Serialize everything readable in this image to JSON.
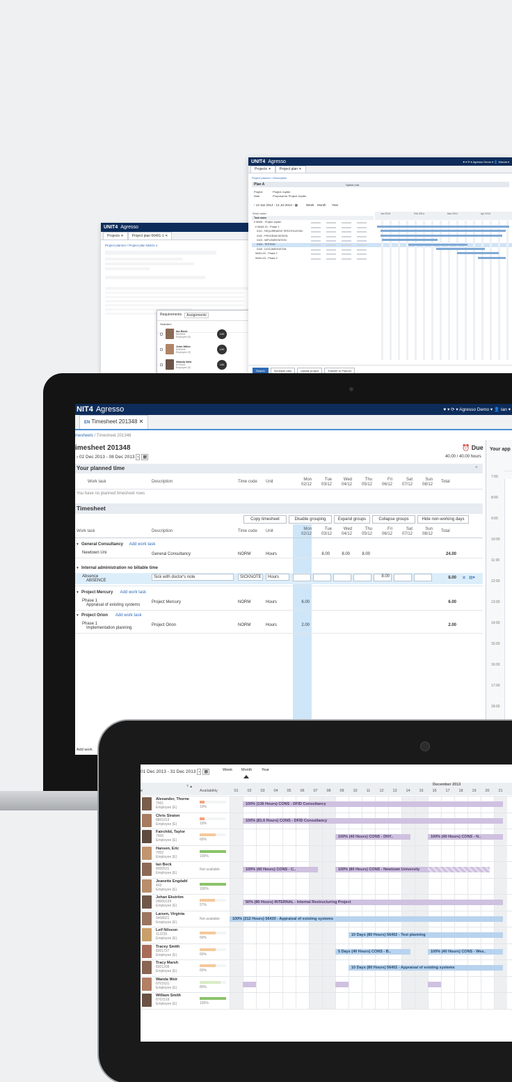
{
  "back_left": {
    "brand": "UNIT4",
    "product": "Agresso",
    "tabs": [
      "Projects ✕",
      "Project plan 06401-1 ✕"
    ],
    "breadcrumb": "Project planner / Project plan 06401-1",
    "popup": {
      "tabs": [
        "Requirements",
        "Assignments"
      ],
      "selected_label": "Selected:",
      "col_name": "Name",
      "people": [
        {
          "name": "Ian Beck",
          "id": "8000531",
          "role": "Employee (E)",
          "badge": "100"
        },
        {
          "name": "John Miller",
          "id": "8000046",
          "role": "Employee (E)",
          "badge": "100"
        },
        {
          "name": "Wanda Weir",
          "id": "8701631",
          "role": "Employee (E)",
          "badge": "100"
        }
      ]
    }
  },
  "back_right": {
    "brand": "UNIT4",
    "product": "Agresso",
    "userbar": "♥ ▾   ⟳ ▾   Agresso Demo ▾   👤 Wanda ▾",
    "tabs": [
      "Projects ✕",
      "Project plan ✕"
    ],
    "breadcrumb": "Project planner / Description",
    "plan_title": "Plan A",
    "plan_option": "Option   List",
    "project_label": "Project",
    "project_value": "Project Jupiter",
    "note_label": "Note",
    "note_value": "Proposal for Project Jupiter",
    "date_range": "‹ 13 Jan 2014 - 13 Jul 2014 ›  ▦",
    "view_modes": [
      "Week",
      "Month",
      "Year"
    ],
    "work_tasks_label": "Work tasks",
    "tasks": [
      {
        "name": "Task name",
        "bold": true
      },
      {
        "name": "▾ 06401 - Project Jupiter",
        "bold": false
      },
      {
        "name": "  ▾ 06401-01 - Phase 1",
        "bold": false
      },
      {
        "name": "    0101 - REQUIREMENT SPECIFICATION",
        "bold": false
      },
      {
        "name": "    0102 - PROGRAM DESIGN",
        "bold": false
      },
      {
        "name": "    0103 - IMPLEMENTATION",
        "bold": false
      },
      {
        "name": "    0104 - TESTING",
        "bold": false,
        "selected": true
      },
      {
        "name": "    0105 - DOCUMENTATION",
        "bold": false
      },
      {
        "name": "  06401-02 - Phase 2",
        "bold": false
      },
      {
        "name": "  06401-03 - Phase 3",
        "bold": false
      }
    ],
    "gantt_months": [
      "Jan 2014",
      "Feb 2014",
      "Mar 2014",
      "Apr 2014"
    ],
    "footer_buttons": [
      "Search",
      "Schedule plan",
      "Update project",
      "Transfer to Planner"
    ]
  },
  "laptop": {
    "brand_partial": "NIT4",
    "product": "Agresso",
    "userbar": "♥ ▾   ⟳ ▾   Agresso Demo ▾   👤 Ian ▾",
    "tab_icon": "EN",
    "tab_label": "Timesheet 201348",
    "breadcrumb": [
      "mesheets",
      "Timesheet 201348"
    ],
    "page_title": "imesheet 201348",
    "date_range": "02 Dec 2013 - 08 Dec 2013",
    "due_label": "Due",
    "hours_summary": "40.00 / 40.00 hours",
    "planned_title": "Your planned time",
    "planned_columns": [
      "Work task",
      "Description",
      "Time code",
      "Unit"
    ],
    "days": [
      {
        "day": "Mon",
        "date": "02/12"
      },
      {
        "day": "Tue",
        "date": "03/12"
      },
      {
        "day": "Wed",
        "date": "04/12"
      },
      {
        "day": "Thu",
        "date": "05/12"
      },
      {
        "day": "Fri",
        "date": "06/12"
      },
      {
        "day": "Sat",
        "date": "07/12"
      },
      {
        "day": "Sun",
        "date": "08/12"
      }
    ],
    "total_label": "Total",
    "no_planned_rows": "You have no planned timesheet rows",
    "timesheet_title": "Timesheet",
    "toolbar": [
      "Copy timesheet",
      "Disable grouping",
      "Expand groups",
      "Collapse groups",
      "Hide non-working days"
    ],
    "ts_columns": [
      "Work task",
      "Description",
      "Time code",
      "Unit"
    ],
    "groups": [
      {
        "title": "General Consultancy",
        "add": "Add work task",
        "rows": [
          {
            "task": "Newtown Uni",
            "sub": "",
            "desc": "General Consultancy",
            "code": "NORM",
            "unit": "Hours",
            "hours": [
              "",
              "8.00",
              "8.00",
              "8.00",
              "",
              "",
              ""
            ],
            "total": "24.00"
          }
        ]
      },
      {
        "title": "Internal administration no billable time",
        "add": "",
        "rows": [
          {
            "task": "Absence",
            "sub": "ABSENCE",
            "desc": "Sick with doctor's note",
            "code": "SICKNOTE",
            "unit": "Hours",
            "hours": [
              "",
              "",
              "",
              "",
              "8.00",
              "",
              ""
            ],
            "total": "8.00",
            "editing": true
          }
        ]
      },
      {
        "title": "Project Mercury",
        "add": "Add work task",
        "rows": [
          {
            "task": "Phase 1",
            "sub": "Appraisal of existing systems",
            "desc": "Project Mercury",
            "code": "NORM",
            "unit": "Hours",
            "hours": [
              "6.00",
              "",
              "",
              "",
              "",
              "",
              ""
            ],
            "total": "6.00"
          }
        ]
      },
      {
        "title": "Project Orion",
        "add": "Add work task",
        "rows": [
          {
            "task": "Phase 1",
            "sub": "Implementation planning",
            "desc": "Project Orion",
            "code": "NORM",
            "unit": "Hours",
            "hours": [
              "2.00",
              "",
              "",
              "",
              "",
              "",
              ""
            ],
            "total": "2.00"
          }
        ]
      }
    ],
    "add_work_label": "Add work",
    "appointments_title": "Your app",
    "cal_times": [
      "7:00",
      "8:00",
      "9:00",
      "10:00",
      "11:00",
      "12:00",
      "13:00",
      "14:00",
      "15:00",
      "16:00",
      "17:00",
      "18:00"
    ]
  },
  "tablet": {
    "date_range": "01 Dec 2013 - 31 Dec 2013",
    "view_modes": [
      "Week",
      "Month",
      "Year"
    ],
    "col_resource_partial": "e",
    "sort_icon": "? ▲",
    "col_availability": "Availability",
    "month_label": "December 2013",
    "days": [
      "01",
      "02",
      "03",
      "04",
      "05",
      "06",
      "07",
      "08",
      "09",
      "10",
      "11",
      "12",
      "13",
      "14",
      "15",
      "16",
      "17",
      "18",
      "19",
      "20",
      "21"
    ],
    "people": [
      {
        "name": "Alexander, Thorne",
        "id": "7001",
        "role": "Employee (E)",
        "avail": "19%",
        "bar_color": "#f3a37a",
        "avail_frac": 0.19
      },
      {
        "name": "Chris Siraton",
        "id": "8801013",
        "role": "Employee (E)",
        "avail": "19%",
        "bar_color": "#f3a37a",
        "avail_frac": 0.19
      },
      {
        "name": "Fairchild, Taylor",
        "id": "7006",
        "role": "Employee (E)",
        "avail": "60%",
        "bar_color": "#f5c99a",
        "avail_frac": 0.6
      },
      {
        "name": "Hansen, Eric",
        "id": "7002",
        "role": "Employee (E)",
        "avail": "100%",
        "bar_color": "#8bc36a",
        "avail_frac": 1.0
      },
      {
        "name": "Ian Beck",
        "id": "8000531",
        "role": "Employee (E)",
        "avail": "Not available",
        "bar_color": "",
        "avail_frac": 0
      },
      {
        "name": "Jeanette Engdahl",
        "id": "403",
        "role": "Employee (E)",
        "avail": "100%",
        "bar_color": "#8bc36a",
        "avail_frac": 1.0
      },
      {
        "name": "Johan Ekström",
        "id": "99000139",
        "role": "Employee (E)",
        "avail": "57%",
        "bar_color": "#f5c99a",
        "avail_frac": 0.57
      },
      {
        "name": "Larsen, Virginia",
        "id": "9408021",
        "role": "Employee (E)",
        "avail": "Not available",
        "bar_color": "",
        "avail_frac": 0
      },
      {
        "name": "Leif Nilsson",
        "id": "112233",
        "role": "Employee (E)",
        "avail": "60%",
        "bar_color": "#f5c99a",
        "avail_frac": 0.6
      },
      {
        "name": "Tracey Smith",
        "id": "8301727",
        "role": "Employee (E)",
        "avail": "60%",
        "bar_color": "#f5c99a",
        "avail_frac": 0.6
      },
      {
        "name": "Tracy Marsh",
        "id": "8301208",
        "role": "Employee (E)",
        "avail": "60%",
        "bar_color": "#f5c99a",
        "avail_frac": 0.6
      },
      {
        "name": "Wanda Weir",
        "id": "8701631",
        "role": "Employee (E)",
        "avail": "80%",
        "bar_color": "#d8ecc5",
        "avail_frac": 0.8
      },
      {
        "name": "William Smith",
        "id": "8701519",
        "role": "Employee (E)",
        "avail": "100%",
        "bar_color": "#8bc36a",
        "avail_frac": 1.0
      }
    ],
    "bookings": [
      {
        "row": 0,
        "start": 2,
        "end": 21,
        "label": "100% (136 Hours) CONS - DFID Consultancy",
        "style": "purple"
      },
      {
        "row": 1,
        "start": 2,
        "end": 21,
        "label": "100% (81.6 Hours) CONS - DFID Consultancy",
        "style": "purple"
      },
      {
        "row": 2,
        "start": 9,
        "end": 14,
        "label": "100% (40 Hours) CONS - DNY..",
        "style": "purple"
      },
      {
        "row": 2,
        "start": 16,
        "end": 21,
        "label": "100% (40 Hours) CONS - N..",
        "style": "purple"
      },
      {
        "row": 4,
        "start": 2,
        "end": 7,
        "label": "100% (40 Hours) CONS - C..",
        "style": "purple"
      },
      {
        "row": 4,
        "start": 9,
        "end": 16,
        "label": "100% (80 Hours) CONS - Newtown University",
        "style": "purple"
      },
      {
        "row": 4,
        "start": 16,
        "end": 20,
        "label": "",
        "style": "stripe"
      },
      {
        "row": 6,
        "start": 2,
        "end": 21,
        "label": "50% (80 Hours) INTERNAL - Internal Restructuring Project",
        "style": "purple"
      },
      {
        "row": 7,
        "start": 1,
        "end": 21,
        "label": "100% (312 Hours) 56430 - Appraisal of existing systems",
        "style": "blue2"
      },
      {
        "row": 8,
        "start": 10,
        "end": 21,
        "label": "10 Days (80 Hours) 56402 - Test planning",
        "style": "blue2"
      },
      {
        "row": 9,
        "start": 9,
        "end": 14,
        "label": "5 Days (40 Hours) CONS - B..",
        "style": "blue2"
      },
      {
        "row": 9,
        "start": 16,
        "end": 21,
        "label": "100% (40 Hours) CONS - Wes..",
        "style": "blue2"
      },
      {
        "row": 10,
        "start": 10,
        "end": 21,
        "label": "10 Days (80 Hours) 56402 - Appraisal of existing systems",
        "style": "blue2"
      },
      {
        "row": 11,
        "start": 2,
        "end": 2.3,
        "label": "",
        "style": "purple"
      },
      {
        "row": 11,
        "start": 9,
        "end": 9.3,
        "label": "",
        "style": "purple"
      },
      {
        "row": 11,
        "start": 16,
        "end": 16.3,
        "label": "",
        "style": "purple"
      }
    ]
  }
}
